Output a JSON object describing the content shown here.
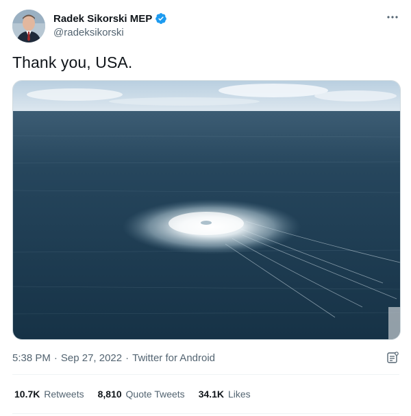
{
  "author": {
    "display_name": "Radek Sikorski MEP",
    "handle": "@radeksikorski",
    "verified": true
  },
  "tweet": {
    "text": "Thank you, USA.",
    "media_description_icon": "ocean-gas-leak-photo"
  },
  "meta": {
    "time": "5:38 PM",
    "date": "Sep 27, 2022",
    "source": "Twitter for Android",
    "separator": "·"
  },
  "stats": {
    "retweets": {
      "count": "10.7K",
      "label": "Retweets"
    },
    "quotes": {
      "count": "8,810",
      "label": "Quote Tweets"
    },
    "likes": {
      "count": "34.1K",
      "label": "Likes"
    }
  },
  "colors": {
    "verified_blue": "#1d9bf0",
    "secondary_text": "#536471",
    "primary_text": "#0f1419",
    "sea_dark": "#1c3a4f",
    "sky": "#c9d9e6"
  },
  "icons": {
    "more": "more-horizontal-icon",
    "verified": "verified-badge-icon",
    "analytics": "tweet-analytics-icon"
  }
}
